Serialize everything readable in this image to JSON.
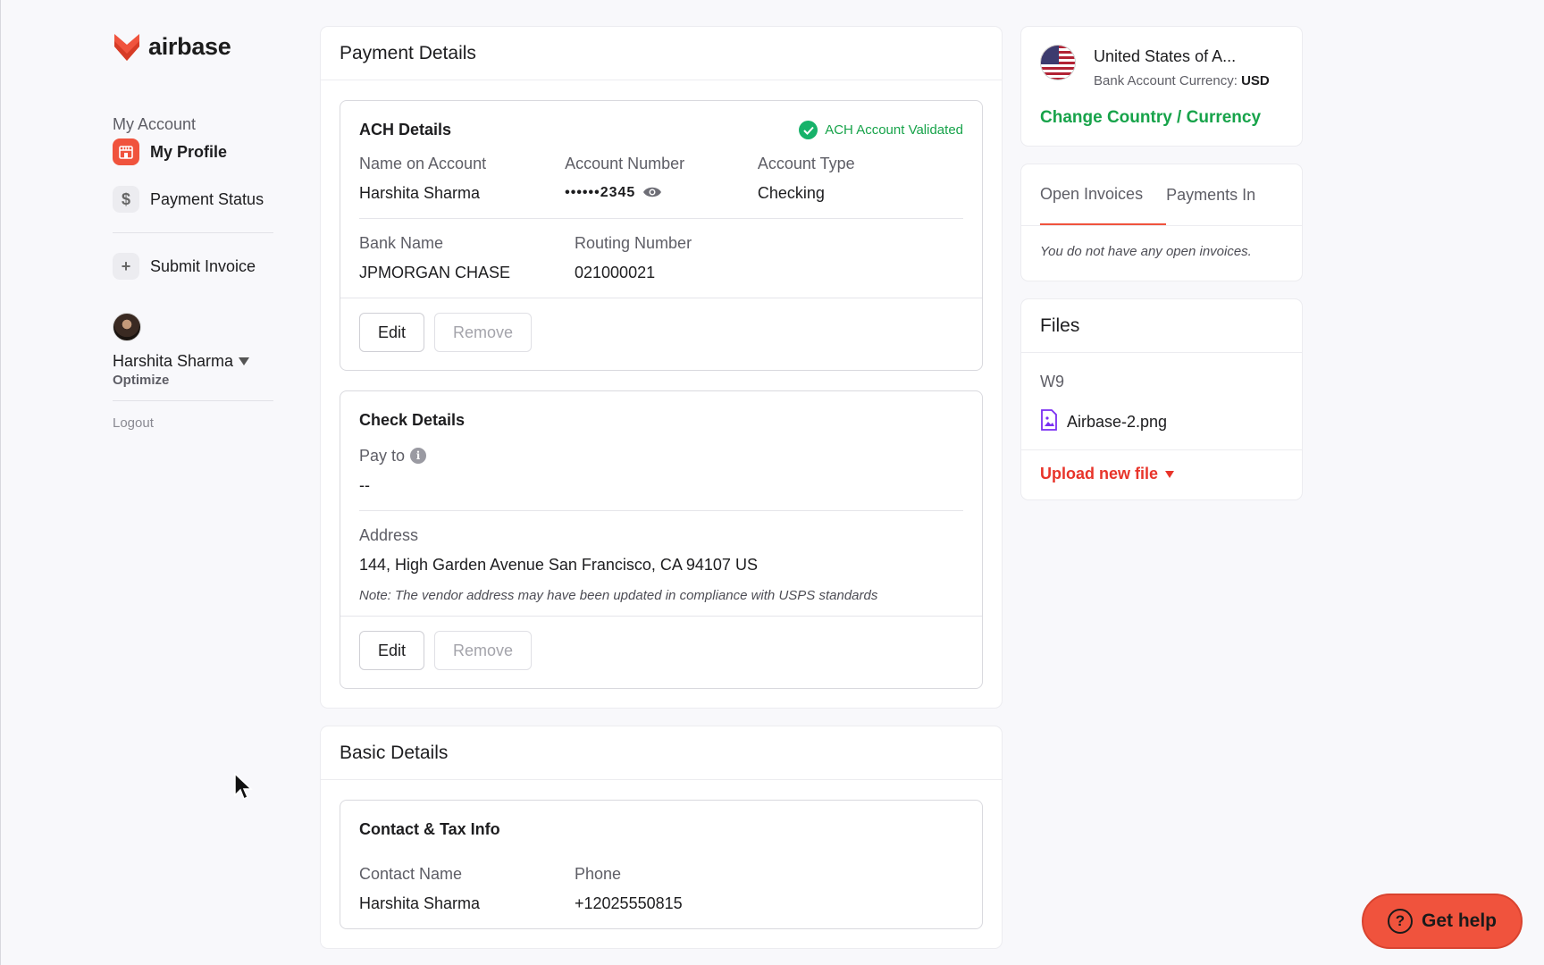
{
  "brand": {
    "name": "airbase",
    "color": "#f0533d"
  },
  "sidebar": {
    "section_label": "My Account",
    "items": [
      {
        "label": "My Profile",
        "icon": "storefront-icon",
        "active": true
      },
      {
        "label": "Payment Status",
        "icon": "dollar-icon",
        "active": false
      },
      {
        "label": "Submit Invoice",
        "icon": "plus-icon",
        "active": false
      }
    ],
    "user": {
      "name": "Harshita Sharma",
      "org": "Optimize"
    },
    "logout_label": "Logout"
  },
  "payment_details": {
    "title": "Payment Details",
    "ach": {
      "title": "ACH Details",
      "status": "ACH Account Validated",
      "name_label": "Name on Account",
      "name_value": "Harshita Sharma",
      "account_number_label": "Account Number",
      "account_number_value": "••••••2345",
      "account_type_label": "Account Type",
      "account_type_value": "Checking",
      "bank_name_label": "Bank Name",
      "bank_name_value": "JPMORGAN CHASE",
      "routing_label": "Routing Number",
      "routing_value": "021000021",
      "edit_label": "Edit",
      "remove_label": "Remove"
    },
    "check": {
      "title": "Check Details",
      "pay_to_label": "Pay to",
      "pay_to_value": "--",
      "address_label": "Address",
      "address_value": "144, High Garden Avenue San Francisco, CA 94107 US",
      "note": "Note: The vendor address may have been updated in compliance with USPS standards",
      "edit_label": "Edit",
      "remove_label": "Remove"
    }
  },
  "basic_details": {
    "title": "Basic Details",
    "contact": {
      "title": "Contact & Tax Info",
      "contact_name_label": "Contact Name",
      "contact_name_value": "Harshita Sharma",
      "phone_label": "Phone",
      "phone_value": "+12025550815"
    }
  },
  "country": {
    "name": "United States of A...",
    "currency_label": "Bank Account Currency:",
    "currency_value": "USD",
    "change_link": "Change Country / Currency"
  },
  "invoices": {
    "tabs": [
      {
        "label": "Open Invoices",
        "active": true
      },
      {
        "label": "Payments In",
        "active": false
      }
    ],
    "empty_message": "You do not have any open invoices."
  },
  "files": {
    "title": "Files",
    "group_label": "W9",
    "file_name": "Airbase-2.png",
    "upload_label": "Upload new file"
  },
  "help": {
    "label": "Get help"
  }
}
